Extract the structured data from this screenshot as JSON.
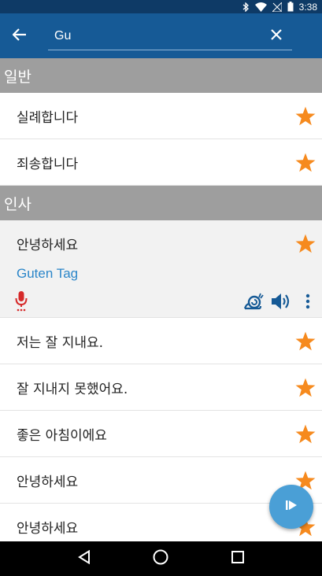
{
  "status_bar": {
    "time": "3:38",
    "icons": [
      "bluetooth-icon",
      "wifi-icon",
      "no-signal-icon",
      "battery-icon"
    ]
  },
  "app_bar": {
    "back_icon": "arrow-back-icon",
    "search": {
      "value": "Gu",
      "placeholder": ""
    },
    "clear_icon": "close-icon"
  },
  "sections": [
    {
      "title": "일반",
      "items": [
        {
          "text": "실례합니다",
          "favorite": true
        },
        {
          "text": "죄송합니다",
          "favorite": true
        }
      ]
    },
    {
      "title": "인사",
      "expanded_item": {
        "text": "안녕하세요",
        "translation": "Guten Tag",
        "favorite": true,
        "actions": [
          "mic-icon",
          "slow-playback-icon",
          "speaker-icon",
          "more-vert-icon"
        ]
      },
      "items": [
        {
          "text": "저는 잘 지내요.",
          "favorite": true
        },
        {
          "text": "잘 지내지 못했어요.",
          "favorite": true
        },
        {
          "text": "좋은 아침이에요",
          "favorite": true
        },
        {
          "text": "안녕하세요",
          "favorite": true
        },
        {
          "text": "안녕하세요",
          "favorite": true
        }
      ]
    }
  ],
  "fab_icon": "play-icon",
  "nav_bar": [
    "back-triangle-icon",
    "home-circle-icon",
    "recents-square-icon"
  ],
  "colors": {
    "status_bar": "#0e3a66",
    "app_bar": "#165a96",
    "section_header": "#9e9e9e",
    "star": "#f68a1e",
    "translation": "#2b86c9",
    "mic": "#d62a2a",
    "fab": "#4a9fd6"
  }
}
